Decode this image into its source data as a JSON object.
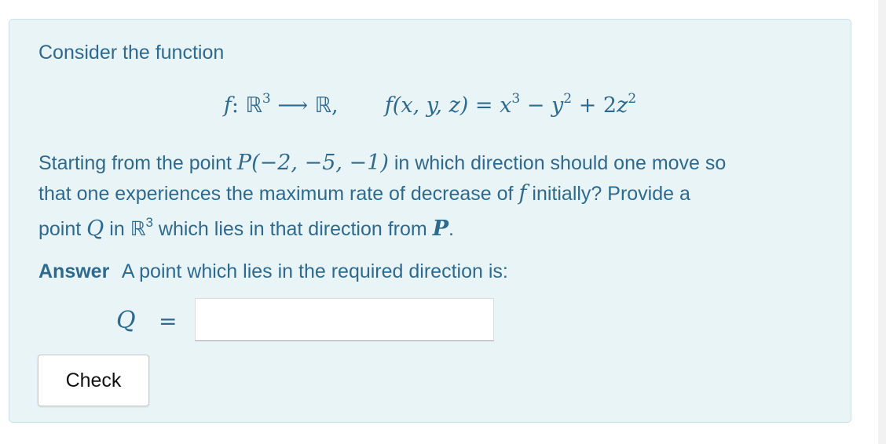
{
  "question": {
    "intro": "Consider the function",
    "display_equation": {
      "f_name": "f",
      "colon": ":",
      "domain": "ℝ",
      "domain_exponent": "3",
      "arrow": "⟶",
      "codomain": "ℝ",
      "comma": ",",
      "lhs": "f(x, y, z)",
      "equals": "=",
      "term1": "x",
      "term1_exp": "3",
      "minus": "−",
      "term2": "y",
      "term2_exp": "2",
      "plus": "+",
      "term3_coef": "2",
      "term3": "z",
      "term3_exp": "2"
    },
    "line1": {
      "text_before": "Starting from the point",
      "point": "P(−2, −5, −1)",
      "text_after": "in which direction should one move so"
    },
    "line2": {
      "text_before": "that one experiences the maximum rate of decrease of",
      "f": "f",
      "text_after": "initially? Provide a"
    },
    "line3": {
      "word_point": "point",
      "Q": "Q",
      "word_in": "in",
      "R": "ℝ",
      "R_exp": "3",
      "text_after": "which lies in that direction from",
      "P": "P",
      "period": "."
    }
  },
  "answer": {
    "label": "Answer",
    "prompt": "A point which lies in the required direction is:",
    "q_symbol": "Q",
    "equals": "=",
    "input_value": ""
  },
  "buttons": {
    "check_label": "Check"
  },
  "colors": {
    "text": "#2e6a8e",
    "panel_background": "#e9f4f7",
    "panel_border": "#c9e2ea"
  }
}
